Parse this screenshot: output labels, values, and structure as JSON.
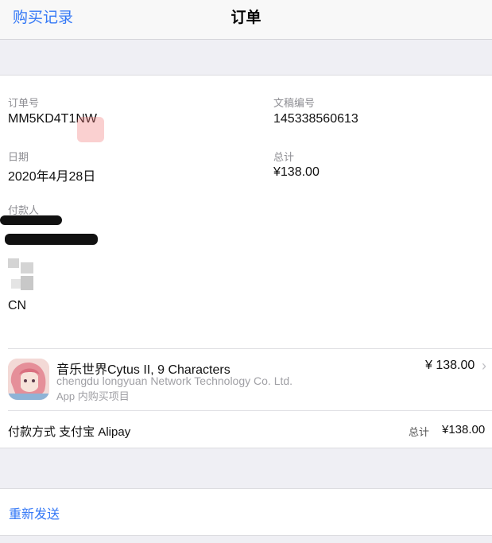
{
  "nav": {
    "back_label": "购买记录",
    "title": "订单"
  },
  "order": {
    "order_no_label": "订单号",
    "order_no": "MM5KD4T1NW",
    "doc_no_label": "文稿编号",
    "doc_no": "145338560613",
    "date_label": "日期",
    "date": "2020年4月28日",
    "total_label": "总计",
    "total": "¥138.00",
    "payer_label": "付款人",
    "country": "CN"
  },
  "item": {
    "icon": "app-icon-cytus",
    "title": "音乐世界Cytus II, 9 Characters",
    "developer": "chengdu longyuan Network Technology Co. Ltd.",
    "type": "App 内购买项目",
    "price": "¥ 138.00"
  },
  "payment": {
    "method_label": "付款方式 支付宝 Alipay",
    "total_label": "总计",
    "total": "¥138.00"
  },
  "actions": {
    "resend_label": "重新发送"
  },
  "colors": {
    "accent": "#3478f6",
    "background": "#efeff4"
  }
}
